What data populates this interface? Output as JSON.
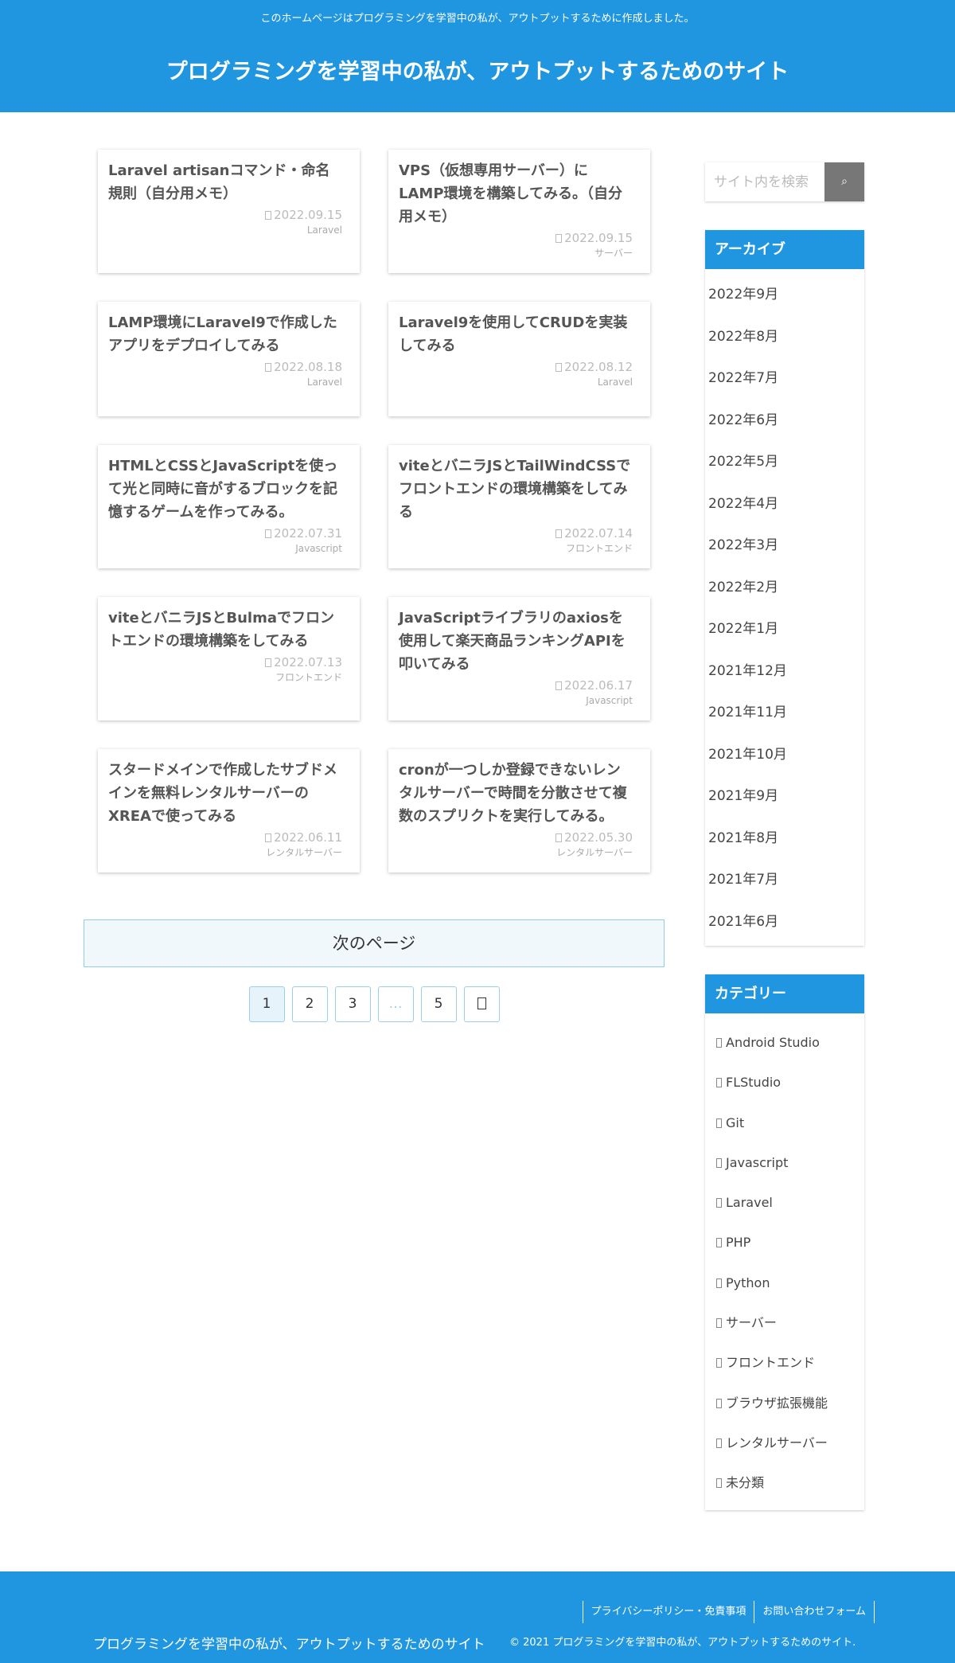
{
  "header": {
    "tagline": "このホームページはプログラミングを学習中の私が、アウトプットするために作成しました。",
    "site_title": "プログラミングを学習中の私が、アウトプットするためのサイト"
  },
  "posts": [
    {
      "title": "Laravel artisanコマンド・命名規則（自分用メモ）",
      "date": "2022.09.15",
      "category": "Laravel"
    },
    {
      "title": "VPS（仮想専用サーバー）にLAMP環境を構築してみる。（自分用メモ）",
      "date": "2022.09.15",
      "category": "サーバー"
    },
    {
      "title": "LAMP環境にLaravel9で作成したアプリをデプロイしてみる",
      "date": "2022.08.18",
      "category": "Laravel"
    },
    {
      "title": "Laravel9を使用してCRUDを実装してみる",
      "date": "2022.08.12",
      "category": "Laravel"
    },
    {
      "title": "HTMLとCSSとJavaScriptを使って光と同時に音がするブロックを記憶するゲームを作ってみる。",
      "date": "2022.07.31",
      "category": "Javascript"
    },
    {
      "title": "viteとバニラJSとTailWindCSSでフロントエンドの環境構築をしてみる",
      "date": "2022.07.14",
      "category": "フロントエンド"
    },
    {
      "title": "viteとバニラJSとBulmaでフロントエンドの環境構築をしてみる",
      "date": "2022.07.13",
      "category": "フロントエンド"
    },
    {
      "title": "JavaScriptライブラリのaxiosを使用して楽天商品ランキングAPIを叩いてみる",
      "date": "2022.06.17",
      "category": "Javascript"
    },
    {
      "title": "スタードメインで作成したサブドメインを無料レンタルサーバーのXREAで使ってみる",
      "date": "2022.06.11",
      "category": "レンタルサーバー"
    },
    {
      "title": "cronが一つしか登録できないレンタルサーバーで時間を分散させて複数のスプリクトを実行してみる。",
      "date": "2022.05.30",
      "category": "レンタルサーバー"
    }
  ],
  "next_page_label": "次のページ",
  "pagination": [
    "1",
    "2",
    "3",
    "…",
    "5"
  ],
  "sidebar": {
    "search_placeholder": "サイト内を検索",
    "search_icon": "search-icon",
    "archive_title": "アーカイブ",
    "archives": [
      "2022年9月",
      "2022年8月",
      "2022年7月",
      "2022年6月",
      "2022年5月",
      "2022年4月",
      "2022年3月",
      "2022年2月",
      "2022年1月",
      "2021年12月",
      "2021年11月",
      "2021年10月",
      "2021年9月",
      "2021年8月",
      "2021年7月",
      "2021年6月"
    ],
    "category_title": "カテゴリー",
    "categories": [
      "Android Studio",
      "FLStudio",
      "Git",
      "Javascript",
      "Laravel",
      "PHP",
      "Python",
      "サーバー",
      "フロントエンド",
      "ブラウザ拡張機能",
      "レンタルサーバー",
      "未分類"
    ]
  },
  "footer": {
    "links": [
      "プライバシーポリシー・免責事項",
      "お問い合わせフォーム"
    ],
    "site_title": "プログラミングを学習中の私が、アウトプットするためのサイト",
    "copyright": "© 2021 プログラミングを学習中の私が、アウトプットするためのサイト."
  },
  "colors": {
    "accent": "#2196e0",
    "button": "#777777"
  }
}
